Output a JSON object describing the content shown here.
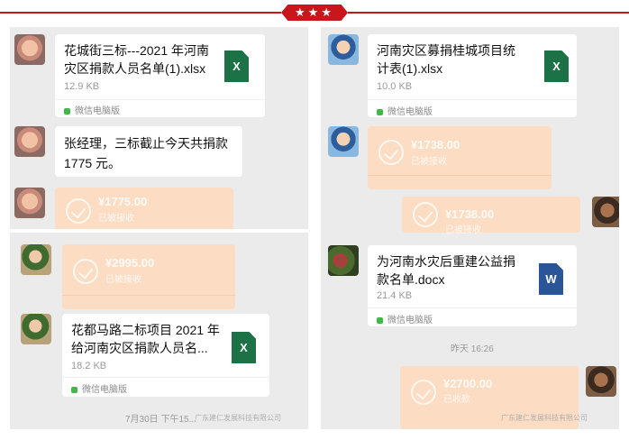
{
  "banner": {
    "stars": "★★★"
  },
  "left_top": {
    "file1": {
      "name": "花城街三标---2021 年河南灾区捐款人员名单(1).xlsx",
      "line1": "花城街三标---2021 年河南",
      "line2": "灾区捐款人员名单(1).xlsx",
      "size": "12.9 KB",
      "source": "微信电脑版",
      "icon": "X"
    },
    "message": {
      "line1": "张经理，三标截止今天共捐款",
      "line2": "1775 元。"
    },
    "transfer": {
      "amount": "¥1775.00",
      "status": "已被接收"
    }
  },
  "left_bottom": {
    "transfer": {
      "amount": "¥2995.00",
      "status": "已被接收"
    },
    "file": {
      "line1": "花都马路二标项目 2021 年",
      "line2": "给河南灾区捐款人员名...",
      "size": "18.2 KB",
      "source": "微信电脑版",
      "icon": "X"
    },
    "time": "7月30日 下午15...",
    "watermark": "广东建仁发展科技有限公司"
  },
  "right": {
    "file1": {
      "line1": "河南灾区募捐桂城项目统",
      "line2": "计表(1).xlsx",
      "size": "10.0 KB",
      "source": "微信电脑版",
      "icon": "X"
    },
    "transfer1": {
      "amount": "¥1738.00",
      "status": "已被接收"
    },
    "transfer2": {
      "amount": "¥1738.00",
      "status": "已被接收"
    },
    "file2": {
      "line1": "为河南水灾后重建公益捐",
      "line2": "款名单.docx",
      "size": "21.4 KB",
      "source": "微信电脑版",
      "icon": "W"
    },
    "time": "昨天 16:26",
    "transfer3": {
      "amount": "¥2700.00",
      "status": "已收款"
    },
    "watermark": "广东建仁发展科技有限公司"
  }
}
